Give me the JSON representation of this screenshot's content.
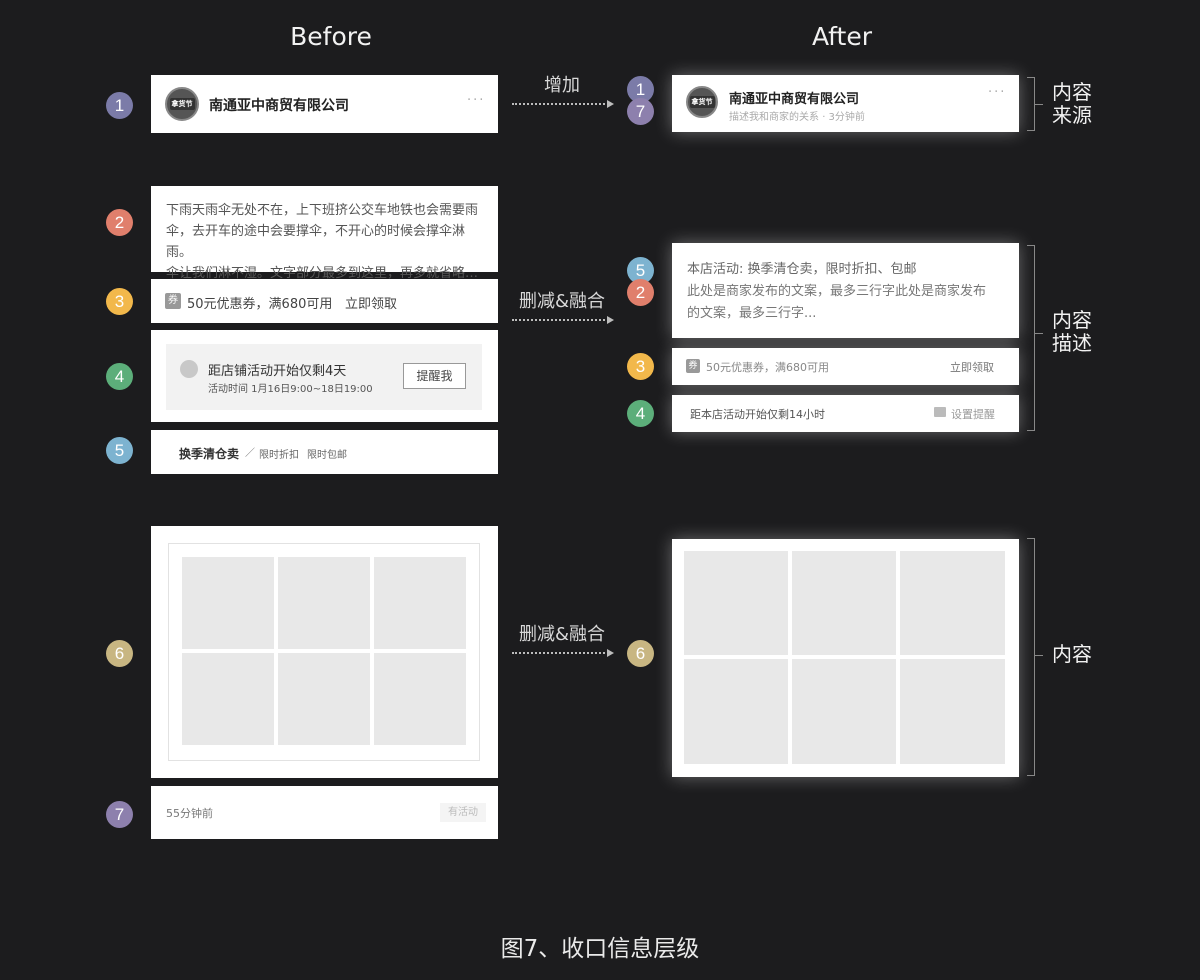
{
  "headings": {
    "before": "Before",
    "after": "After"
  },
  "caption": "图7、收口信息层级",
  "colors": {
    "background": "#1c1c1e",
    "badge_1": "#7b7ba8",
    "badge_2": "#e07f6c",
    "badge_3": "#f2b84b",
    "badge_4": "#5cae7a",
    "badge_5": "#7db3d0",
    "badge_6": "#c8b682",
    "badge_7": "#8d80ad"
  },
  "badges": {
    "b1": "1",
    "b2": "2",
    "b3": "3",
    "b4": "4",
    "b5": "5",
    "b6": "6",
    "b7": "7"
  },
  "arrows": {
    "add": "增加",
    "merge_1": "删减&融合",
    "merge_2": "删减&融合"
  },
  "side_labels": {
    "source_l1": "内容",
    "source_l2": "来源",
    "desc_l1": "内容",
    "desc_l2": "描述",
    "content": "内容"
  },
  "before": {
    "header": {
      "logo_text": "拿货节",
      "shop_name": "南通亚中商贸有限公司",
      "more_icon": "more-dots-icon"
    },
    "text": {
      "line1": "下雨天雨伞无处不在，上下班挤公交车地铁也会需要雨",
      "line2": "伞，去开车的途中会要撑伞，不开心的时候会撑伞淋雨。",
      "line3": "伞让我们淋不湿。文字部分最多到这里，再多就省略…"
    },
    "coupon": {
      "tag": "券",
      "text": "50元优惠券，满680可用",
      "action": "立即领取"
    },
    "reminder": {
      "title_prefix": "距店铺活动开始仅剩",
      "title_days": "4天",
      "time": "活动时间 1月16日9:00~18日19:00",
      "button": "提醒我"
    },
    "activity": {
      "name": "换季清仓卖",
      "sep": "／",
      "tag1": "限时折扣",
      "tag2": "限时包邮"
    },
    "footer": {
      "time": "55分钟前",
      "tag": "有活动"
    }
  },
  "after": {
    "header": {
      "logo_text": "拿货节",
      "shop_name": "南通亚中商贸有限公司",
      "meta_relation": "描述我和商家的关系",
      "meta_time": "· 3分钟前",
      "more_icon": "more-dots-icon"
    },
    "desc": {
      "activity_line": "本店活动: 换季清仓卖，限时折扣、包邮",
      "text_line1": "此处是商家发布的文案，最多三行字此处是商家发布",
      "text_line2": "的文案，最多三行字..."
    },
    "coupon": {
      "tag": "券",
      "text": "50元优惠券，满680可用",
      "action": "立即领取"
    },
    "reminder": {
      "text": "距本店活动开始仅剩14小时",
      "action": "设置提醒"
    }
  }
}
